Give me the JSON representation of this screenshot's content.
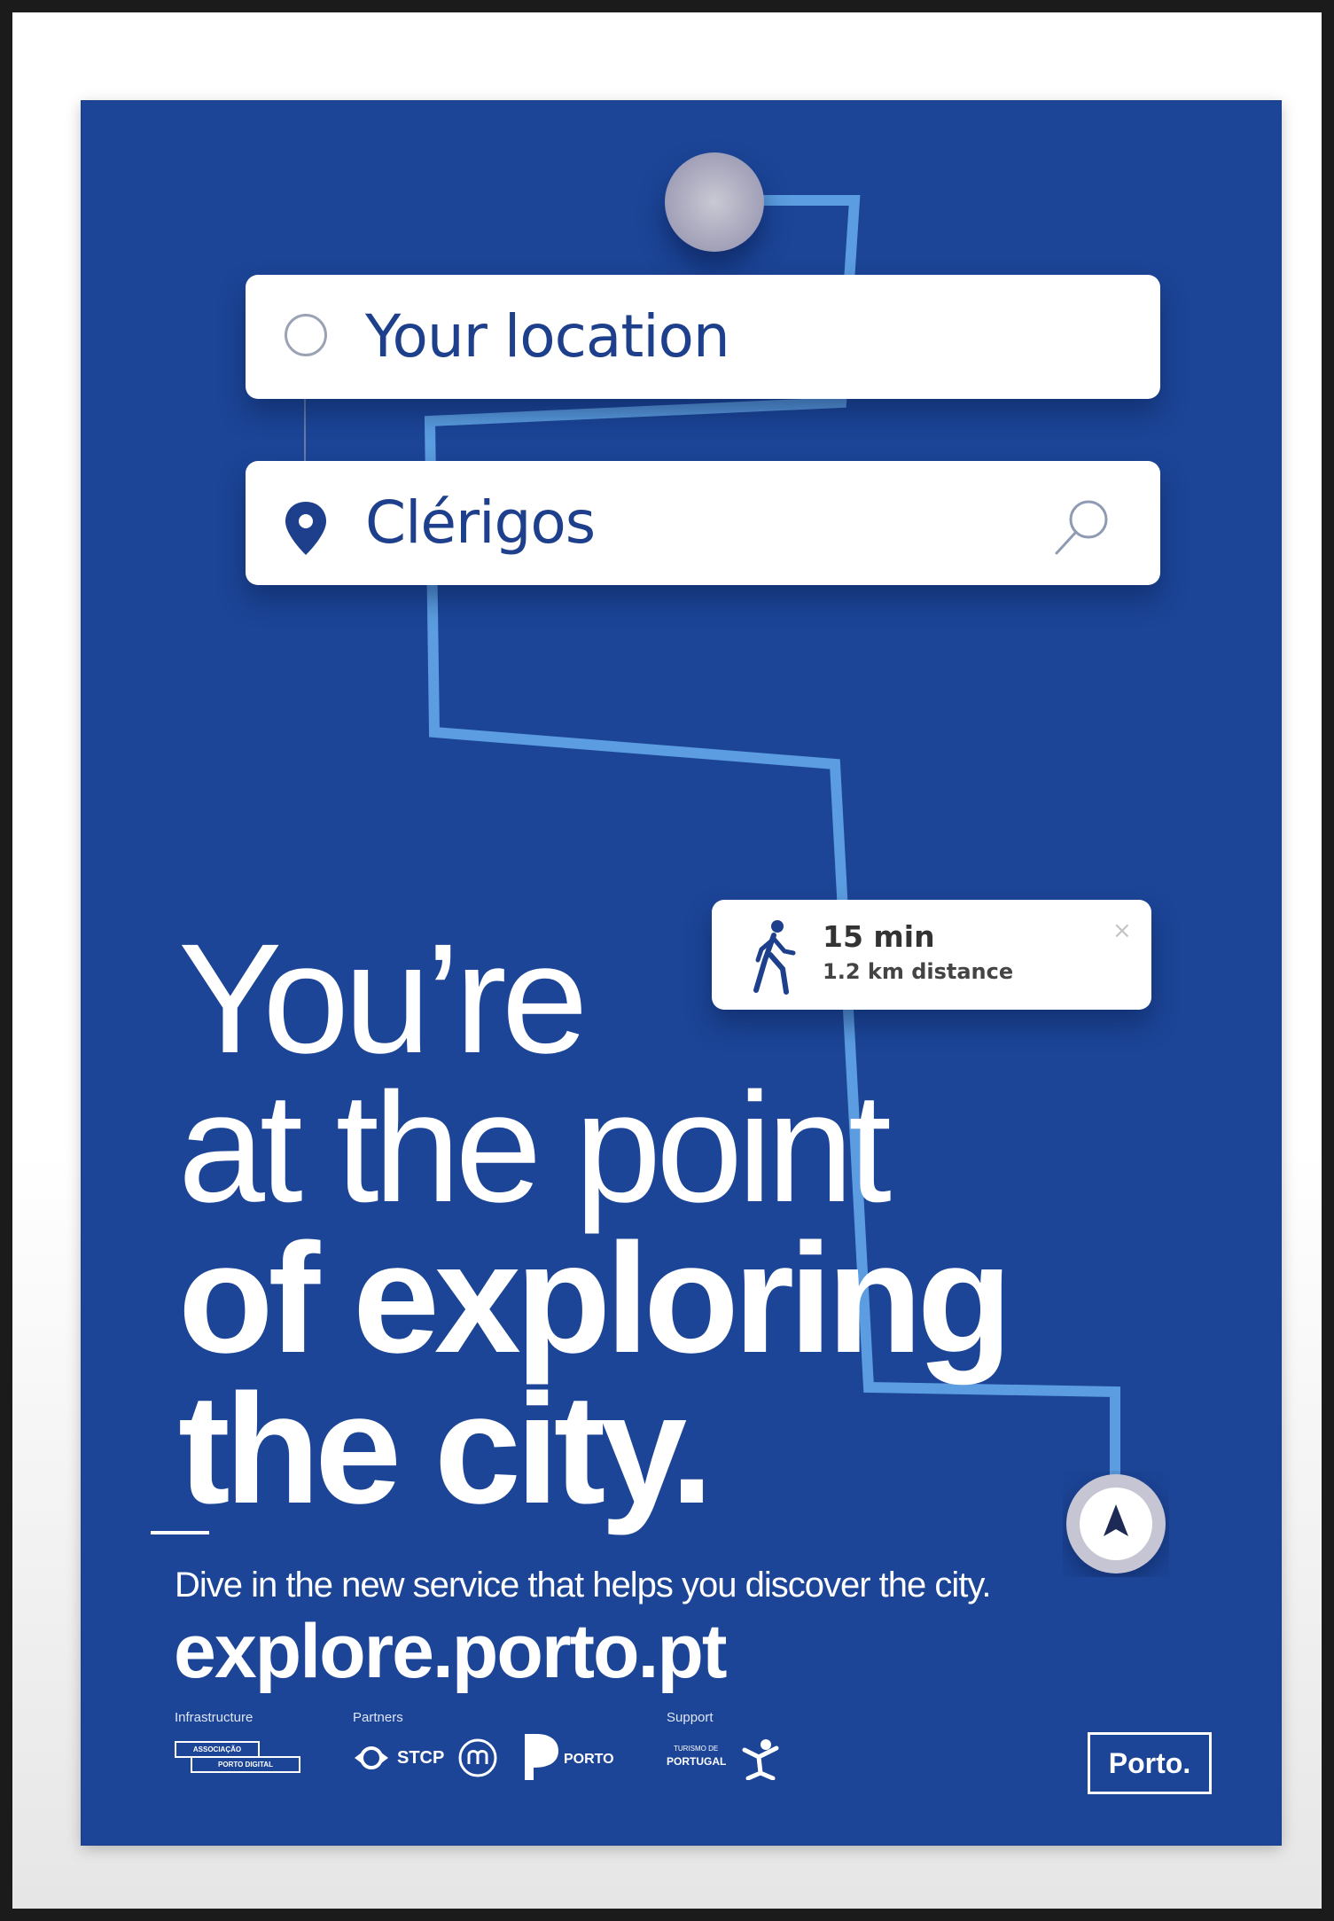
{
  "search": {
    "from_text": "Your location",
    "to_text": "Clérigos"
  },
  "walk_card": {
    "time": "15 min",
    "distance": "1.2 km distance",
    "close": "×"
  },
  "headline": {
    "line1": "You’re",
    "line2": "at the point",
    "line3": "of exploring",
    "line4": "the city."
  },
  "tagline": "Dive in the new service that helps you discover the city.",
  "url": "explore.porto.pt",
  "footer": {
    "infrastructure_label": "Infrastructure",
    "partners_label": "Partners",
    "support_label": "Support",
    "adp_line1": "ASSOCIAÇÃO",
    "adp_line2": "PORTO DIGITAL",
    "stcp": "STCP",
    "ap_porto": "PORTO",
    "tp_line1": "TURISMO DE",
    "tp_line2": "PORTUGAL",
    "porto_logo": "Porto."
  },
  "colors": {
    "poster_blue": "#1c4597",
    "route_line": "#5b9de0",
    "text_blue": "#1d3f8c"
  },
  "icons": [
    "circle-origin-icon",
    "location-pin-icon",
    "search-icon",
    "walking-person-icon",
    "close-icon",
    "navigation-arrow-icon"
  ]
}
